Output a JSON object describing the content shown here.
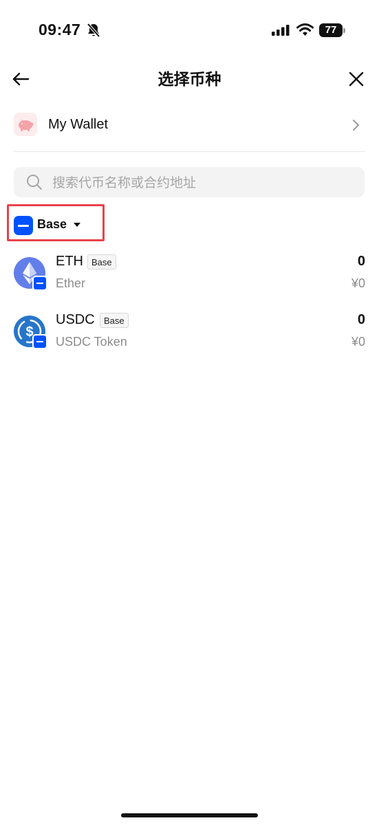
{
  "status_bar": {
    "time": "09:47",
    "battery": "77",
    "icons": [
      "bell-slash-icon",
      "signal-icon",
      "wifi-icon",
      "battery-icon"
    ]
  },
  "header": {
    "title": "选择币种",
    "back_icon": "arrow-left-icon",
    "close_icon": "close-icon"
  },
  "wallet": {
    "label": "My Wallet",
    "icon": "piggy-bank-icon",
    "chevron_icon": "chevron-right-icon"
  },
  "search": {
    "placeholder": "搜索代币名称或合约地址",
    "value": "",
    "icon": "search-icon"
  },
  "network_selector": {
    "label": "Base",
    "icon": "base-chain-icon",
    "caret_icon": "caret-down-icon",
    "highlight_color": "#e8424a"
  },
  "tokens": [
    {
      "symbol": "ETH",
      "chain": "Base",
      "name": "Ether",
      "amount": "0",
      "value": "¥0",
      "icon": "ethereum-icon"
    },
    {
      "symbol": "USDC",
      "chain": "Base",
      "name": "USDC Token",
      "amount": "0",
      "value": "¥0",
      "icon": "usdc-icon"
    }
  ],
  "colors": {
    "base_blue": "#0052ff",
    "eth_purple": "#627eea",
    "usdc_blue": "#2775ca",
    "secondary_text": "#8c8c8c"
  }
}
